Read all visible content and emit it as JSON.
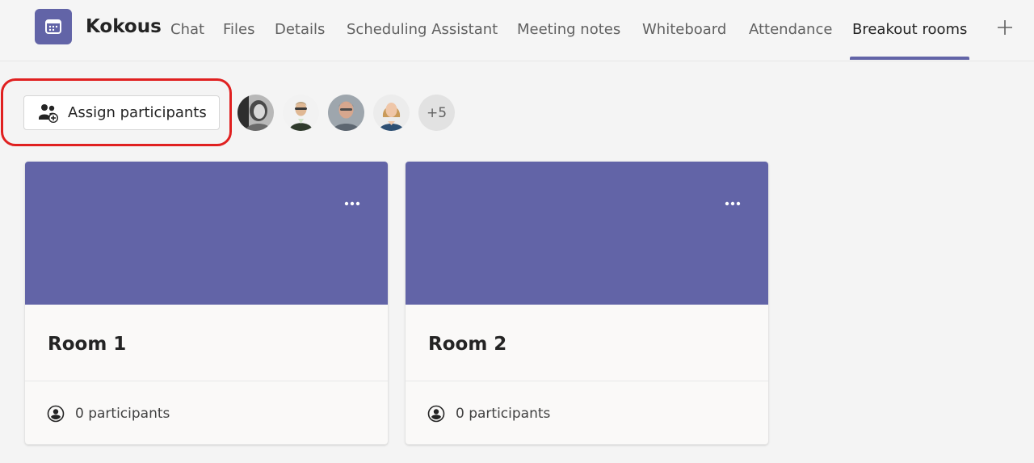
{
  "header": {
    "app_icon": "calendar-icon",
    "title": "Kokous",
    "tabs": [
      {
        "label": "Chat",
        "active": false
      },
      {
        "label": "Files",
        "active": false
      },
      {
        "label": "Details",
        "active": false
      },
      {
        "label": "Scheduling Assistant",
        "active": false
      },
      {
        "label": "Meeting notes",
        "active": false
      },
      {
        "label": "Whiteboard",
        "active": false
      },
      {
        "label": "Attendance",
        "active": false
      },
      {
        "label": "Breakout rooms",
        "active": true
      }
    ],
    "add_tab_icon": "plus-icon",
    "accent_color": "#6264a7"
  },
  "toolbar": {
    "assign_label": "Assign participants",
    "assign_icon": "people-add-icon",
    "highlight_color": "#e02020",
    "more_count": "+5"
  },
  "rooms": [
    {
      "name": "Room 1",
      "participants": "0 participants"
    },
    {
      "name": "Room 2",
      "participants": "0 participants"
    }
  ]
}
